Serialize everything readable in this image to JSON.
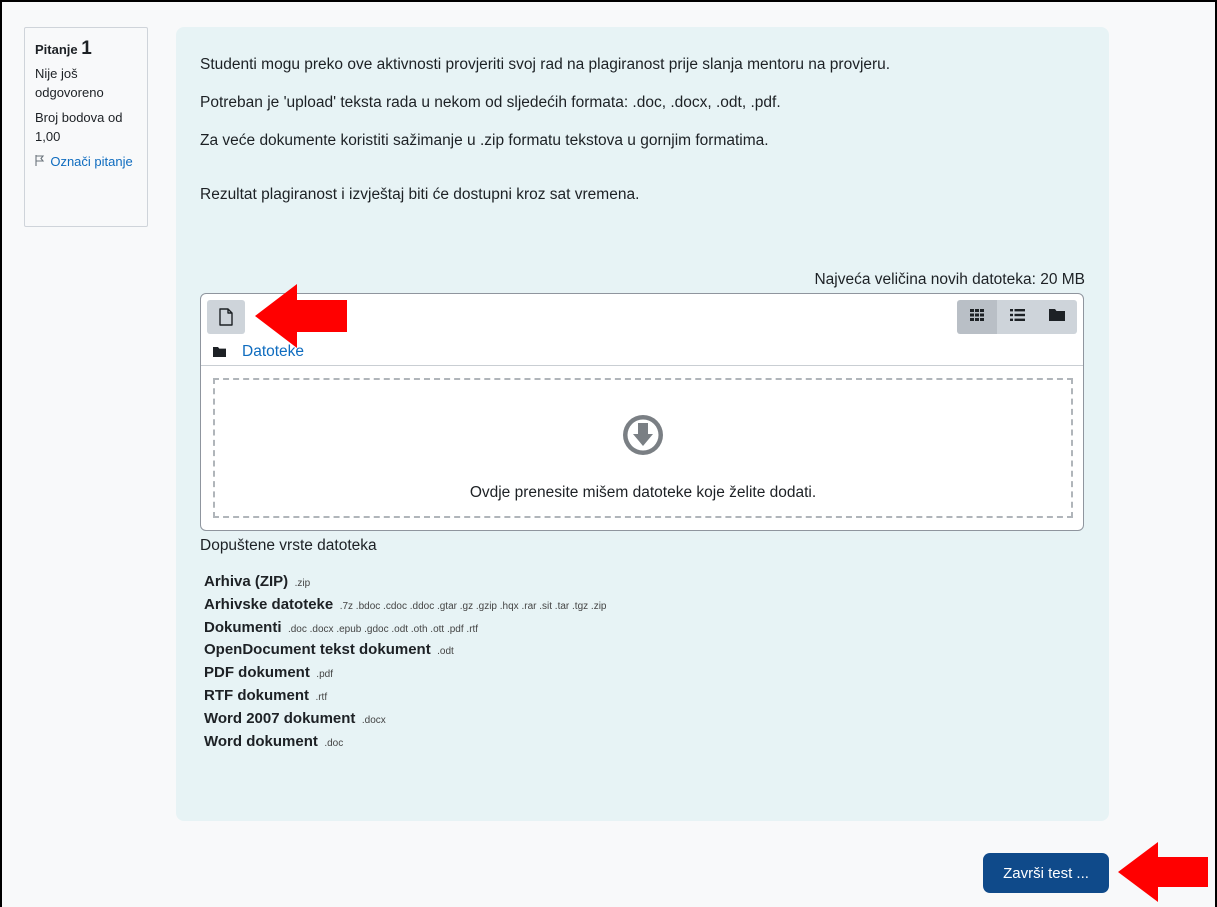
{
  "question_info": {
    "label": "Pitanje",
    "number": "1",
    "status": "Nije još odgovoreno",
    "points": "Broj bodova od 1,00",
    "flag_label": "Označi pitanje"
  },
  "question_text": [
    "Studenti mogu preko ove aktivnosti provjeriti svoj rad na plagiranost prije slanja mentoru na provjeru.",
    "Potreban je 'upload' teksta rada u nekom od sljedećih formata: .doc, .docx, .odt, .pdf.",
    "Za veće dokumente koristiti sažimanje u .zip formatu tekstova u gornjim formatima.",
    "Rezultat plagiranost i izvještaj biti će dostupni kroz sat vremena."
  ],
  "filepicker": {
    "max_size": "Najveća veličina novih datoteka: 20 MB",
    "path_label": "Datoteke",
    "dropzone_message": "Ovdje prenesite mišem datoteke koje želite dodati."
  },
  "accepted_types": {
    "title": "Dopuštene vrste datoteka",
    "items": [
      {
        "name": "Arhiva (ZIP)",
        "ext": ".zip"
      },
      {
        "name": "Arhivske datoteke",
        "ext": ".7z .bdoc .cdoc .ddoc .gtar .gz .gzip .hqx .rar .sit .tar .tgz .zip"
      },
      {
        "name": "Dokumenti",
        "ext": ".doc .docx .epub .gdoc .odt .oth .ott .pdf .rtf"
      },
      {
        "name": "OpenDocument tekst dokument",
        "ext": ".odt"
      },
      {
        "name": "PDF dokument",
        "ext": ".pdf"
      },
      {
        "name": "RTF dokument",
        "ext": ".rtf"
      },
      {
        "name": "Word 2007 dokument",
        "ext": ".docx"
      },
      {
        "name": "Word dokument",
        "ext": ".doc"
      }
    ]
  },
  "finish_button": "Završi test ...",
  "colors": {
    "accent": "#0f6cbf",
    "button": "#0f4a8a",
    "annotation_arrow": "#ff0000",
    "content_bg": "#e7f3f5"
  },
  "icons": [
    "file-icon",
    "grid-view-icon",
    "list-view-icon",
    "tree-view-icon",
    "folder-icon",
    "download-icon",
    "flag-icon",
    "red-arrow-icon"
  ]
}
